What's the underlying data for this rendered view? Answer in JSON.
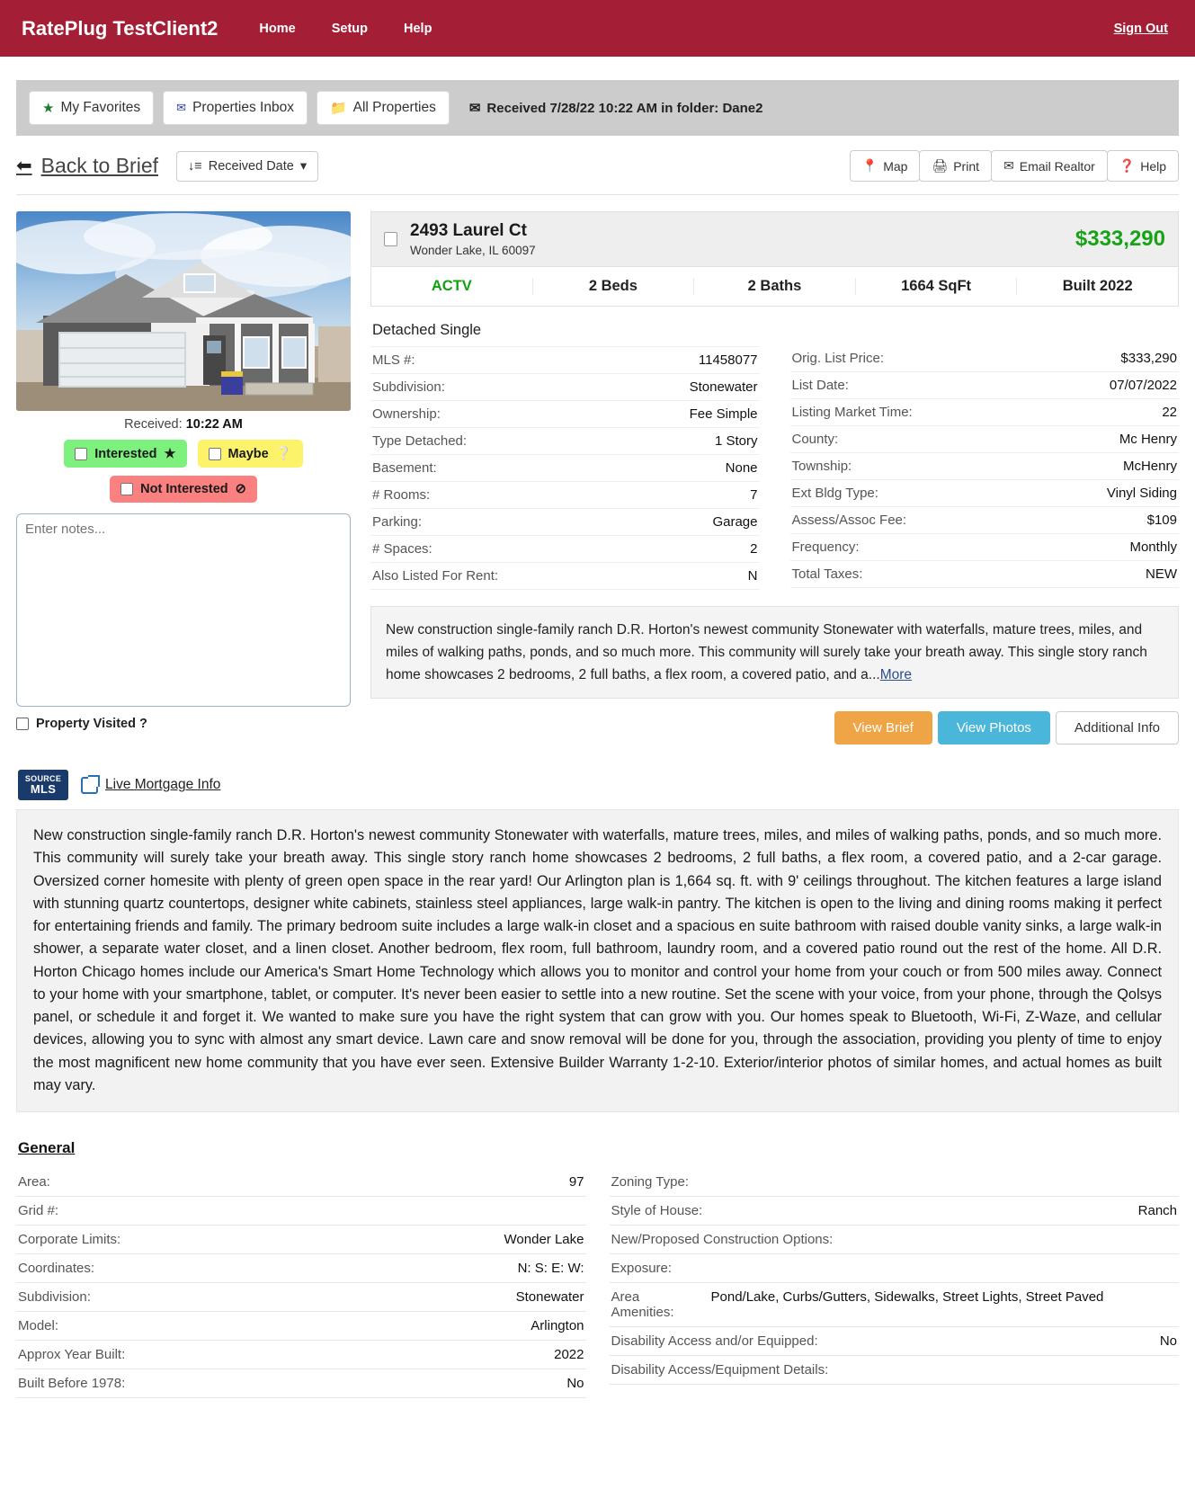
{
  "navbar": {
    "brand": "RatePlug TestClient2",
    "links": [
      {
        "label": "Home"
      },
      {
        "label": "Setup"
      },
      {
        "label": "Help"
      }
    ],
    "signout": "Sign Out"
  },
  "toolbar": {
    "favorites": "My Favorites",
    "inbox": "Properties Inbox",
    "all": "All Properties",
    "received_note": "Received 7/28/22 10:22 AM in folder: Dane2"
  },
  "actionrow": {
    "back": "Back to Brief",
    "sort": "Received Date",
    "map": "Map",
    "print": "Print",
    "email": "Email Realtor",
    "help": "Help"
  },
  "photo": {
    "received_label": "Received:",
    "received_time": "10:22 AM"
  },
  "flags": {
    "interested": "Interested",
    "maybe": "Maybe",
    "not_interested": "Not Interested",
    "notes_placeholder": "Enter notes...",
    "visited": "Property Visited ?"
  },
  "listing": {
    "address": "2493 Laurel Ct",
    "city_state_zip": "Wonder Lake, IL 60097",
    "price": "$333,290",
    "stats": [
      {
        "label": "ACTV",
        "highlight": true
      },
      {
        "label": "2 Beds"
      },
      {
        "label": "2 Baths"
      },
      {
        "label": "1664 SqFt"
      },
      {
        "label": "Built 2022"
      }
    ],
    "left_title": "Detached Single",
    "left_rows": [
      {
        "label": "MLS #:",
        "value": "11458077"
      },
      {
        "label": "Subdivision:",
        "value": "Stonewater"
      },
      {
        "label": "Ownership:",
        "value": "Fee Simple"
      },
      {
        "label": "Type Detached:",
        "value": "1 Story"
      },
      {
        "label": "Basement:",
        "value": "None"
      },
      {
        "label": "# Rooms:",
        "value": "7"
      },
      {
        "label": "Parking:",
        "value": "Garage"
      },
      {
        "label": "# Spaces:",
        "value": "2"
      },
      {
        "label": "Also Listed For Rent:",
        "value": "N"
      }
    ],
    "right_rows": [
      {
        "label": "Orig. List Price:",
        "value": "$333,290"
      },
      {
        "label": "List Date:",
        "value": "07/07/2022"
      },
      {
        "label": "Listing Market Time:",
        "value": "22"
      },
      {
        "label": "County:",
        "value": "Mc Henry"
      },
      {
        "label": "Township:",
        "value": "McHenry"
      },
      {
        "label": "Ext Bldg Type:",
        "value": "Vinyl Siding"
      },
      {
        "label": "Assess/Assoc Fee:",
        "value": "$109"
      },
      {
        "label": "Frequency:",
        "value": "Monthly"
      },
      {
        "label": "Total Taxes:",
        "value": "NEW"
      }
    ],
    "teaser": "New construction single-family ranch D.R. Horton's newest community Stonewater with waterfalls, mature trees, miles, and miles of walking paths, ponds, and so much more. This community will surely take your breath away. This single story ranch home showcases 2 bedrooms, 2 full baths, a flex room, a covered patio, and a...",
    "teaser_more": "More",
    "btn_view_brief": "View Brief",
    "btn_view_photos": "View Photos",
    "btn_additional": "Additional Info"
  },
  "mls": {
    "logo_line1": "SOURCE",
    "logo_line2": "MLS",
    "live_link": "Live Mortgage Info"
  },
  "description": "New construction single-family ranch D.R. Horton's newest community Stonewater with waterfalls, mature trees, miles, and miles of walking paths, ponds, and so much more. This community will surely take your breath away. This single story ranch home showcases 2 bedrooms, 2 full baths, a flex room, a covered patio, and a 2-car garage. Oversized corner homesite with plenty of green open space in the rear yard! Our Arlington plan is 1,664 sq. ft. with 9' ceilings throughout. The kitchen features a large island with stunning quartz countertops, designer white cabinets, stainless steel appliances, large walk-in pantry. The kitchen is open to the living and dining rooms making it perfect for entertaining friends and family. The primary bedroom suite includes a large walk-in closet and a spacious en suite bathroom with raised double vanity sinks, a large walk-in shower, a separate water closet, and a linen closet. Another bedroom, flex room, full bathroom, laundry room, and a covered patio round out the rest of the home. All D.R. Horton Chicago homes include our America's Smart Home Technology which allows you to monitor and control your home from your couch or from 500 miles away. Connect to your home with your smartphone, tablet, or computer. It's never been easier to settle into a new routine. Set the scene with your voice, from your phone, through the Qolsys panel, or schedule it and forget it. We wanted to make sure you have the right system that can grow with you. Our homes speak to Bluetooth, Wi-Fi, Z-Waze, and cellular devices, allowing you to sync with almost any smart device. Lawn care and snow removal will be done for you, through the association, providing you plenty of time to enjoy the most magnificent new home community that you have ever seen. Extensive Builder Warranty 1-2-10. Exterior/interior photos of similar homes, and actual homes as built may vary.",
  "general": {
    "heading": "General",
    "left_rows": [
      {
        "label": "Area:",
        "value": "97"
      },
      {
        "label": "Grid #:",
        "value": ""
      },
      {
        "label": "Corporate Limits:",
        "value": "Wonder Lake"
      },
      {
        "label": "Coordinates:",
        "value": "N: S: E: W:"
      },
      {
        "label": "Subdivision:",
        "value": "Stonewater"
      },
      {
        "label": "Model:",
        "value": "Arlington"
      },
      {
        "label": "Approx Year Built:",
        "value": "2022"
      },
      {
        "label": "Built Before 1978:",
        "value": "No"
      }
    ],
    "right_rows": [
      {
        "label": "Zoning Type:",
        "value": "",
        "wrap": false
      },
      {
        "label": "Style of House:",
        "value": "Ranch",
        "wrap": false
      },
      {
        "label": "New/Proposed Construction Options:",
        "value": "",
        "wrap": false
      },
      {
        "label": "Exposure:",
        "value": "",
        "wrap": false
      },
      {
        "label": "Area Amenities:",
        "value": "Pond/Lake, Curbs/Gutters, Sidewalks, Street Lights, Street Paved",
        "wrap": true
      },
      {
        "label": "Disability Access and/or Equipped:",
        "value": "No",
        "wrap": false
      },
      {
        "label": "Disability Access/Equipment Details:",
        "value": "",
        "wrap": false
      }
    ]
  },
  "colors": {
    "brand_red": "#a41f35",
    "price_green": "#17a317",
    "orange": "#efa546",
    "blue": "#4ab6d9"
  }
}
